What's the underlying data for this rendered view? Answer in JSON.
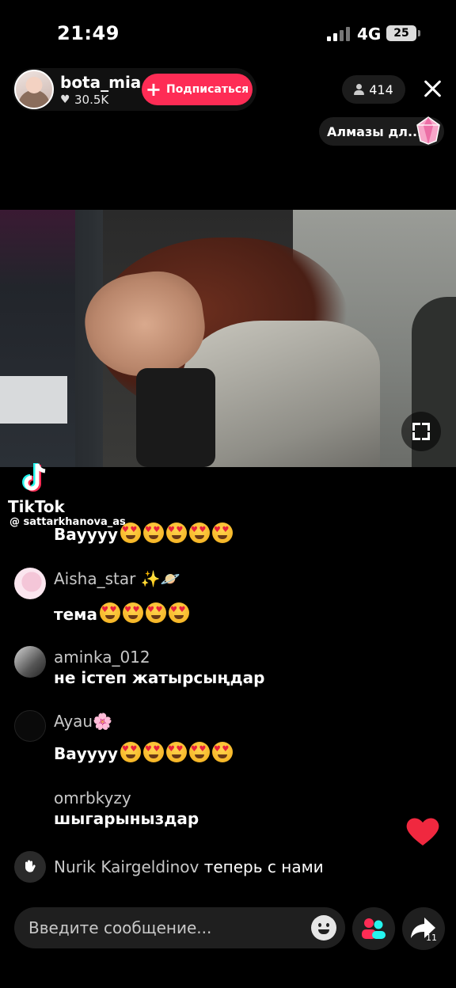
{
  "status_bar": {
    "time": "21:49",
    "network": "4G",
    "battery": "25"
  },
  "host": {
    "name": "bota_mia",
    "likes": "30.5K",
    "follow_label": "Подписаться"
  },
  "viewers": {
    "count": "414"
  },
  "diamonds": {
    "label": "Алмазы дл..."
  },
  "watermark": {
    "brand": "TikTok",
    "handle": "@ sattarkhanova_as"
  },
  "comments": {
    "first_text": "Вауууу",
    "items": [
      {
        "name": "Aisha_star ✨🪐",
        "text": "тема"
      },
      {
        "name": "aminka_012",
        "text": "не істеп жатырсыңдар"
      },
      {
        "name": "Ayau🌸",
        "text": "Вауууу"
      },
      {
        "name": "omrbkyzy",
        "text": "шыгарыныздар"
      }
    ],
    "join": {
      "name": "Nurik Kairgeldinov",
      "text": "теперь с нами"
    }
  },
  "input": {
    "placeholder": "Введите сообщение..."
  },
  "share": {
    "count": "11"
  },
  "icons": [
    "heart-icon",
    "plus-icon",
    "person-icon",
    "close-icon",
    "gem-icon",
    "fullscreen-icon",
    "tiktok-logo-icon",
    "wave-hand-icon",
    "smile-icon",
    "people-icon",
    "share-icon"
  ],
  "colors": {
    "accent": "#fe2c55",
    "heart": "#e8233b"
  }
}
